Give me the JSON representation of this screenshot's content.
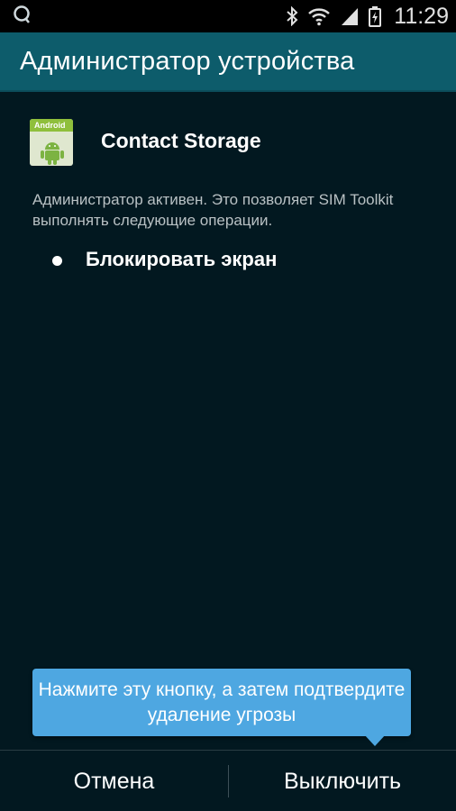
{
  "status_bar": {
    "left_icon": "search-icon",
    "icons": [
      "bluetooth-icon",
      "wifi-icon",
      "signal-icon",
      "battery-charging-icon"
    ],
    "time": "11:29"
  },
  "action_bar": {
    "title": "Администратор устройства"
  },
  "app": {
    "icon": "android-app-icon",
    "icon_label": "Android",
    "name": "Contact Storage"
  },
  "description": "Администратор активен. Это позволяет SIM Toolkit выполнять следующие операции.",
  "permissions": [
    {
      "label": "Блокировать экран"
    }
  ],
  "tooltip": {
    "text": "Нажмите эту кнопку, а затем подтвердите удаление угрозы",
    "color": "#4ea7e1"
  },
  "buttons": {
    "cancel": "Отмена",
    "disable": "Выключить"
  },
  "colors": {
    "background": "#021820",
    "action_bar": "#0d5c6b"
  }
}
